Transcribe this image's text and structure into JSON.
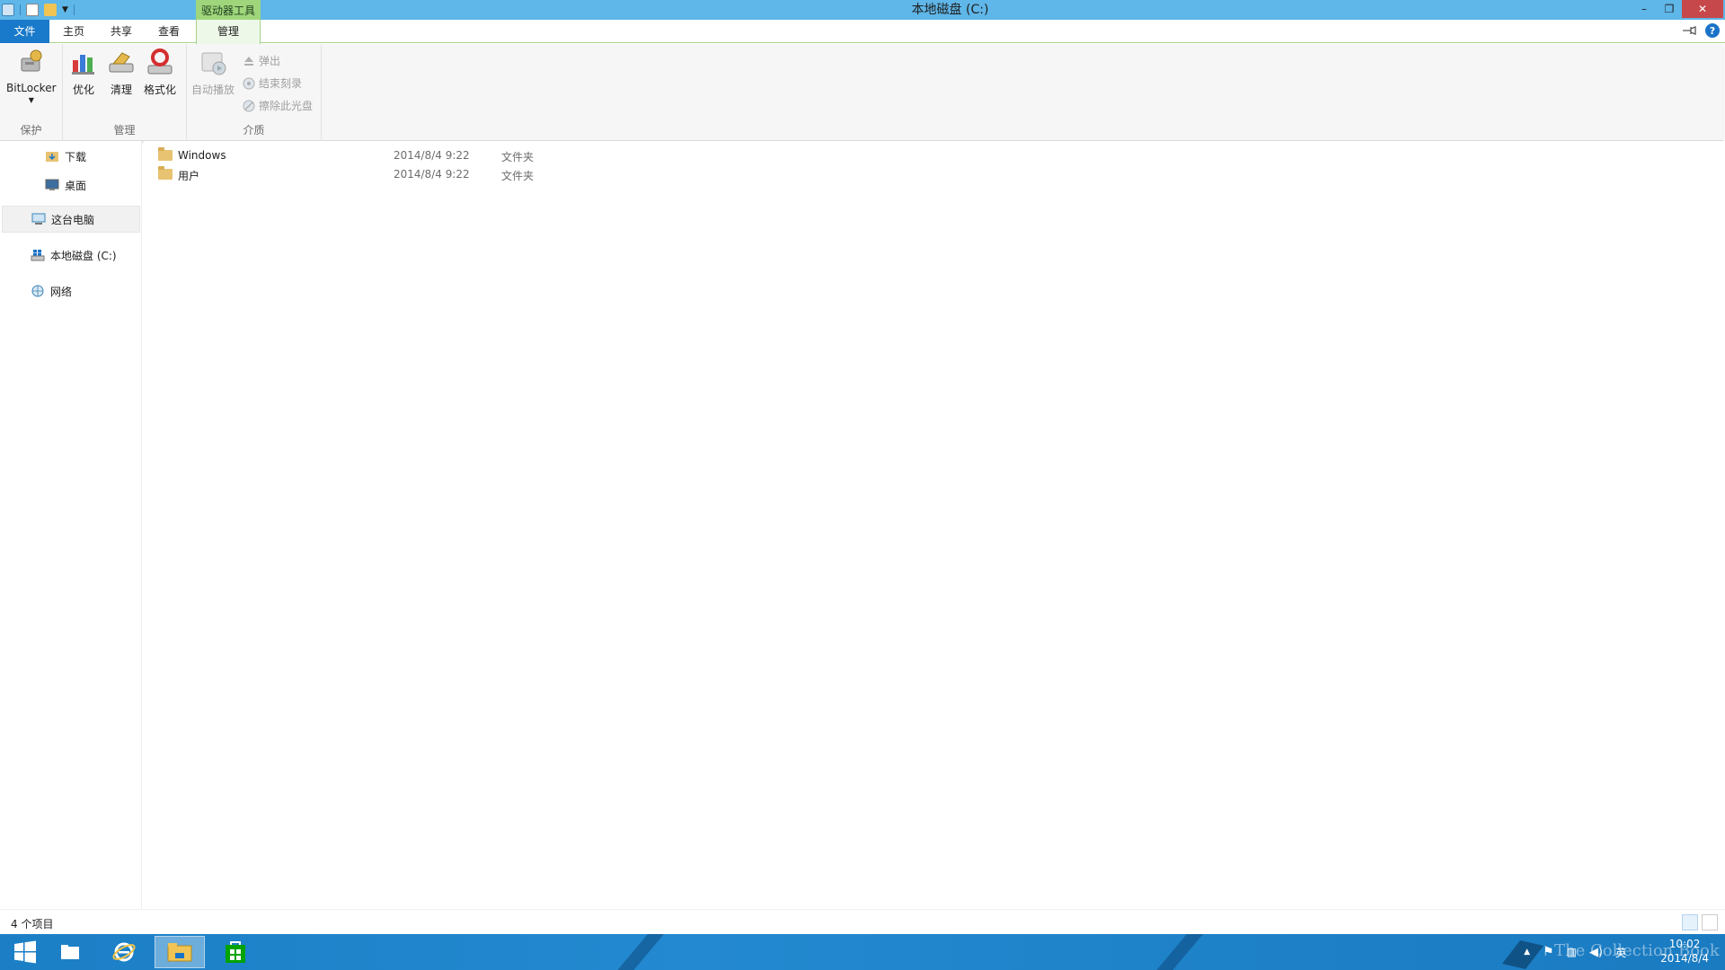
{
  "window": {
    "title": "本地磁盘 (C:)",
    "context_tab_group": "驱动器工具",
    "controls": {
      "minimize": "–",
      "restore": "❐",
      "close": "✕"
    }
  },
  "ribbon_tabs": [
    {
      "label": "文件"
    },
    {
      "label": "主页"
    },
    {
      "label": "共享"
    },
    {
      "label": "查看"
    },
    {
      "label": "管理"
    }
  ],
  "ribbon": {
    "groups": {
      "protect": {
        "label": "保护"
      },
      "manage": {
        "label": "管理"
      },
      "media": {
        "label": "介质"
      }
    },
    "buttons": {
      "bitlocker": "BitLocker",
      "optimize": "优化",
      "cleanup": "清理",
      "format": "格式化",
      "autoplay": "自动播放",
      "eject": "弹出",
      "finish_burning": "结束刻录",
      "erase_disc": "擦除此光盘"
    }
  },
  "nav_pane": {
    "items": [
      {
        "label": "下载",
        "icon": "download-folder-icon"
      },
      {
        "label": "桌面",
        "icon": "desktop-folder-icon"
      },
      {
        "label": "这台电脑",
        "icon": "computer-icon"
      },
      {
        "label": "本地磁盘 (C:)",
        "icon": "local-disk-icon"
      },
      {
        "label": "网络",
        "icon": "network-icon"
      }
    ]
  },
  "files": [
    {
      "name": "Windows",
      "date": "2014/8/4 9:22",
      "type": "文件夹"
    },
    {
      "name": "用户",
      "date": "2014/8/4 9:22",
      "type": "文件夹"
    }
  ],
  "status": {
    "item_count": "4 个项目"
  },
  "taskbar": {
    "tray_lang": "英",
    "clock_time": "10:02",
    "clock_date": "2014/8/4",
    "watermark": "The Collection Book"
  },
  "colors": {
    "titlebar": "#5fb6e8",
    "file_tab": "#1979ca",
    "context_tab": "#9fd67b",
    "taskbar": "#1f84c9"
  }
}
